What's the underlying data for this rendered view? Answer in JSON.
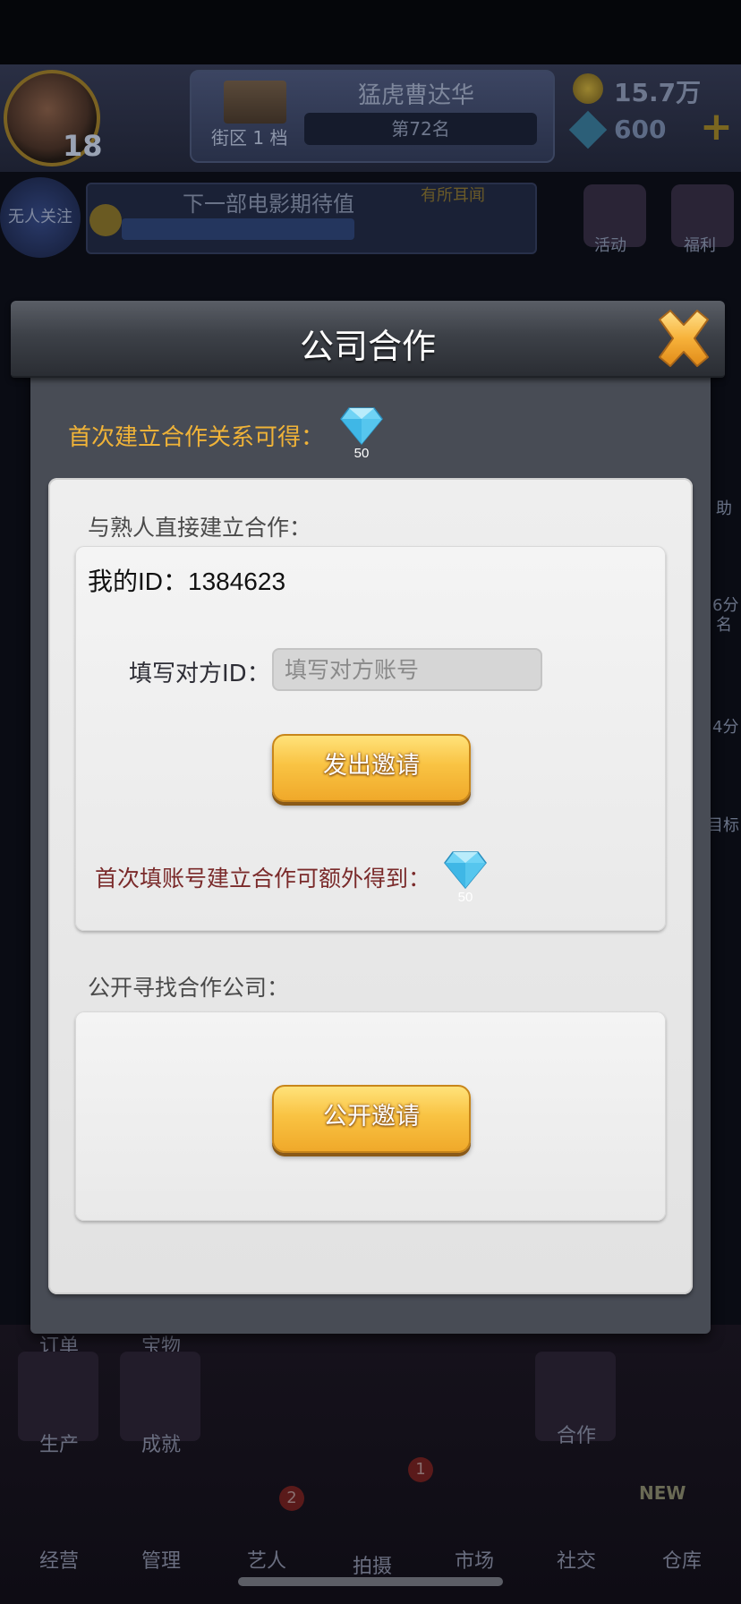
{
  "hud": {
    "level": "18",
    "district_label": "街区 1 档",
    "player_name": "猛虎曹达华",
    "rank": "第72名",
    "coins": "15.7万",
    "gems": "600",
    "plus": "+",
    "follow_label": "无人关注",
    "expectation_label": "下一部电影期待值",
    "rumor_label": "有所耳闻",
    "side_activity": "活动",
    "side_welfare": "福利",
    "side_help": "助",
    "side_score1": "6分",
    "side_rank": "名",
    "side_score2": "4分",
    "side_goal": "目标"
  },
  "bottom_nav": {
    "order": "订单",
    "treasure": "宝物",
    "produce": "生产",
    "achievement": "成就",
    "cooperate": "合作",
    "operate": "经营",
    "manage": "管理",
    "artist": "艺人",
    "artist_badge": "2",
    "shoot": "拍摄",
    "shoot_badge": "1",
    "market": "市场",
    "social": "社交",
    "warehouse": "仓库",
    "new_tag": "NEW"
  },
  "modal": {
    "title": "公司合作",
    "first_reward_text": "首次建立合作关系可得：",
    "first_reward_amount": "50",
    "direct_section_title": "与熟人直接建立合作：",
    "my_id_label": "我的ID：",
    "my_id_value": "1384623",
    "fill_id_label": "填写对方ID：",
    "fill_id_placeholder": "填写对方账号",
    "send_invite_button": "发出邀请",
    "extra_reward_text": "首次填账号建立合作可额外得到：",
    "extra_reward_amount": "50",
    "public_section_title": "公开寻找合作公司：",
    "public_invite_button": "公开邀请"
  },
  "colors": {
    "gold_text": "#f0b338",
    "extra_reward_text": "#7a2a2a",
    "button_gold": "#f9c343",
    "close_x": "#f5a623"
  },
  "icons": {
    "close": "close-x-icon",
    "gem": "diamond-gem-icon"
  }
}
